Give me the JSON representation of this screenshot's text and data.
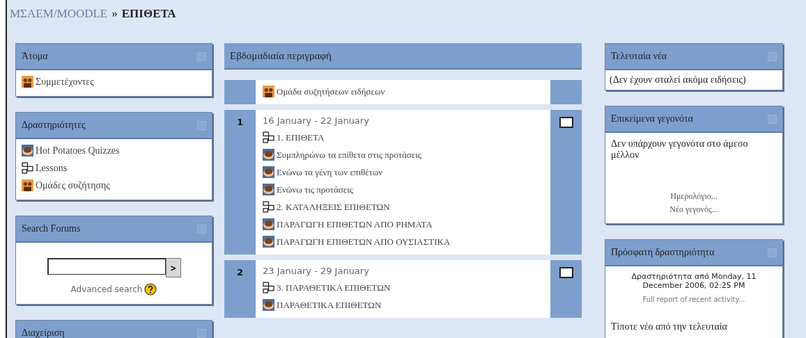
{
  "breadcrumb": {
    "site": "ΜΣΑΕΜ/MOODLE",
    "separator": "»",
    "current": "ΕΠΙΘΕΤΑ"
  },
  "left_blocks": [
    {
      "title": "Άτομα",
      "kind": "links",
      "items": [
        {
          "label": "Συμμετέχοντες",
          "kind": "forum"
        }
      ]
    },
    {
      "title": "Δραστηριότητες",
      "kind": "links",
      "items": [
        {
          "label": "Hot Potatoes Quizzes",
          "kind": "quiz"
        },
        {
          "label": "Lessons",
          "kind": "lesson"
        },
        {
          "label": "Ομάδες συζήτησης",
          "kind": "forum"
        }
      ]
    },
    {
      "title": "Search Forums",
      "kind": "search",
      "button": ">",
      "advanced": "Advanced search"
    },
    {
      "title": "Διαχείριση",
      "kind": "links"
    }
  ],
  "main": {
    "title": "Εβδομαδιαία περιγραφή",
    "sections": [
      {
        "items": [
          {
            "label": "Ομάδα συζητήσεων ειδήσεων",
            "kind": "forum"
          }
        ]
      },
      {
        "number": "1",
        "dates": "16 January - 22 January",
        "items": [
          {
            "label": "1. ΕΠΙΘΕΤΑ",
            "kind": "lesson"
          },
          {
            "label": "Συμπληρώνω τα επίθετα στις προτάσεις",
            "kind": "quiz"
          },
          {
            "label": "Ενώνω τα γένη των επιθέτων",
            "kind": "quiz"
          },
          {
            "label": "Ενώνω τις προτάσεις",
            "kind": "quiz"
          },
          {
            "label": "2. ΚΑΤΑΛΗΞΕΙΣ ΕΠΙΘΕΤΩΝ",
            "kind": "lesson"
          },
          {
            "label": "ΠΑΡΑΓΩΓΗ ΕΠΙΘΕΤΩΝ ΑΠΟ ΡΗΜΑΤΑ",
            "kind": "quiz"
          },
          {
            "label": "ΠΑΡΑΓΩΓΗ ΕΠΙΘΕΤΩΝ ΑΠΟ ΟΥΣΙΑΣΤΙΚΑ",
            "kind": "quiz"
          }
        ]
      },
      {
        "number": "2",
        "dates": "23 January - 29 January",
        "items": [
          {
            "label": "3. ΠΑΡΑΘΕΤΙΚΑ ΕΠΙΘΕΤΩΝ",
            "kind": "lesson"
          },
          {
            "label": "ΠΑΡΑΘΕΤΙΚΑ ΕΠΙΘΕΤΩΝ",
            "kind": "quiz"
          }
        ]
      }
    ]
  },
  "right_blocks": [
    {
      "title": "Τελευταία νέα",
      "kind": "text",
      "text": "(Δεν έχουν σταλεί ακόμα ειδήσεις)"
    },
    {
      "title": "Επικείμενα γεγονότα",
      "kind": "events",
      "text": "Δεν υπάρχουν γεγονότα στο άμεσο μέλλον",
      "links": [
        "Ημερολόγιο...",
        "Νέο γεγονός..."
      ]
    },
    {
      "title": "Πρόσφατη δραστηριότητα",
      "kind": "activity",
      "since": "Δραστηριότητα από Monday, 11 December 2006, 02:25 PM",
      "report": "Full report of recent activity...",
      "text": "Τίποτε νέο από την τελευταία"
    }
  ]
}
